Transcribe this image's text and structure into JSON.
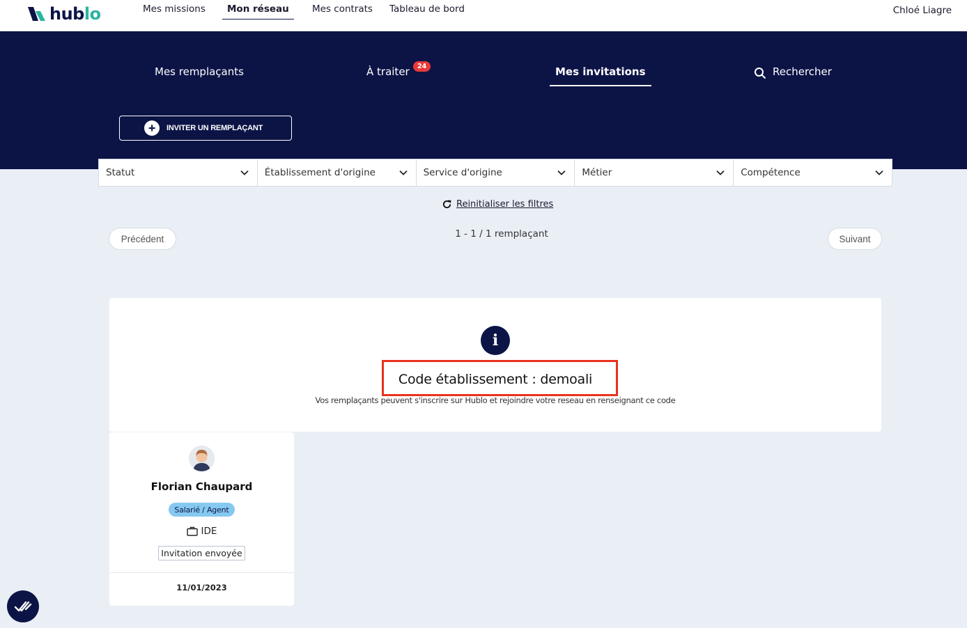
{
  "brand": {
    "part1": "hub",
    "part2": "lo",
    "color": "#0c1446",
    "accent": "#2bb5a0"
  },
  "topnav": {
    "items": [
      {
        "label": "Mes missions"
      },
      {
        "label": "Mon réseau",
        "active": true
      },
      {
        "label": "Mes contrats"
      },
      {
        "label": "Tableau de bord"
      }
    ],
    "user": "Chloé Liagre"
  },
  "tabs": [
    {
      "label": "Mes remplaçants"
    },
    {
      "label": "À traiter",
      "badge": "24"
    },
    {
      "label": "Mes invitations",
      "active": true
    },
    {
      "label": "Rechercher",
      "icon": "search-icon"
    }
  ],
  "invite_button": {
    "label": "INVITER UN REMPLAÇANT",
    "icon": "plus-circle-icon"
  },
  "filters": [
    {
      "label": "Statut"
    },
    {
      "label": "Établissement d'origine"
    },
    {
      "label": "Service d'origine"
    },
    {
      "label": "Métier"
    },
    {
      "label": "Compétence"
    }
  ],
  "reset_filters": {
    "label": "Reinitialiser les filtres",
    "icon": "refresh-icon"
  },
  "pagination": {
    "prev": "Précédent",
    "next": "Suivant",
    "count": "1 - 1 / 1 remplaçant"
  },
  "info": {
    "icon": "info-icon",
    "title": "Code établissement : demoali",
    "subtitle": "Vos remplaçants peuvent s'inscrire sur Hublo et rejoindre votre reseau en renseignant ce code",
    "highlight_color": "#e8321e"
  },
  "cards": [
    {
      "name": "Florian Chaupard",
      "role": "Salarié / Agent",
      "job": "IDE",
      "status": "Invitation envoyée",
      "date": "11/01/2023"
    }
  ],
  "colors": {
    "navy": "#0c1446",
    "badge_red": "#e83a3a",
    "role_blue": "#86c9f0",
    "page_bg": "#eaeff6"
  }
}
